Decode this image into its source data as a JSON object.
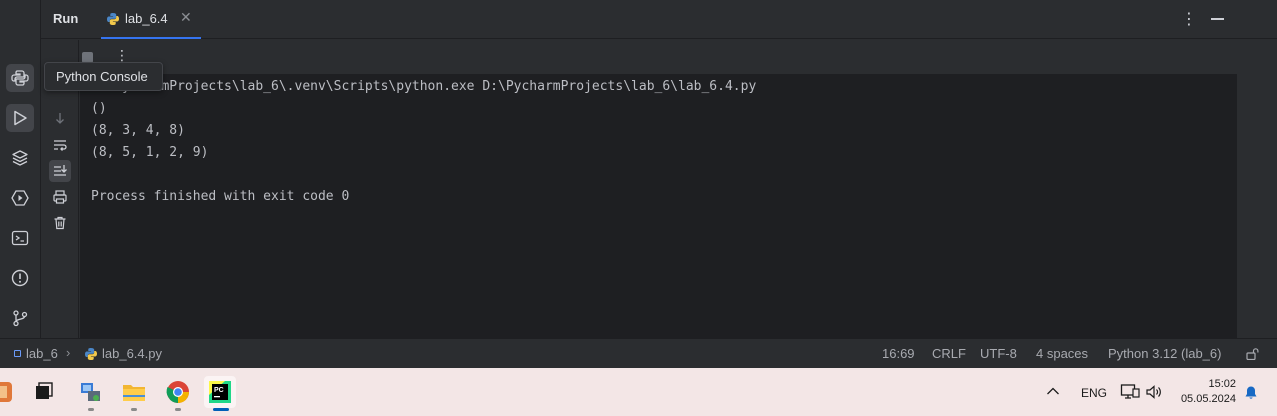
{
  "run_panel": {
    "title": "Run",
    "tab_label": "lab_6.4",
    "tooltip": "Python Console"
  },
  "console": {
    "lines": [
      "D:\\PycharmProjects\\lab_6\\.venv\\Scripts\\python.exe D:\\PycharmProjects\\lab_6\\lab_6.4.py",
      "()",
      "(8, 3, 4, 8)",
      "(8, 5, 1, 2, 9)",
      "",
      "Process finished with exit code 0"
    ]
  },
  "statusbar": {
    "project": "lab_6",
    "file": "lab_6.4.py",
    "position": "16:69",
    "line_separator": "CRLF",
    "encoding": "UTF-8",
    "indent": "4 spaces",
    "interpreter": "Python 3.12 (lab_6)"
  },
  "taskbar": {
    "language": "ENG",
    "time": "15:02",
    "date": "05.05.2024"
  },
  "colors": {
    "accent": "#3574f0",
    "console_bg": "#1e1f22",
    "panel_bg": "#2b2d30",
    "taskbar_bg": "#f3e6e6"
  }
}
